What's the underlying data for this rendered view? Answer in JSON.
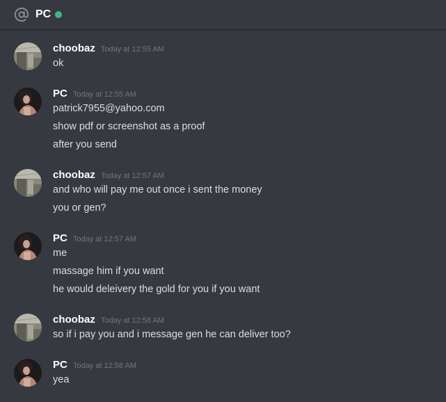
{
  "header": {
    "icon": "at-icon",
    "title": "PC",
    "status_color": "#43b581"
  },
  "messages": [
    {
      "author": "choobaz",
      "timestamp": "Today at 12:55 AM",
      "avatar": "choobaz-avatar",
      "lines": [
        "ok"
      ]
    },
    {
      "author": "PC",
      "timestamp": "Today at 12:55 AM",
      "avatar": "pc-avatar",
      "lines": [
        "patrick7955@yahoo.com",
        "show pdf or screenshot as a proof",
        "after you send"
      ]
    },
    {
      "author": "choobaz",
      "timestamp": "Today at 12:57 AM",
      "avatar": "choobaz-avatar",
      "lines": [
        "and who will pay me out once i sent the money",
        "you or gen?"
      ]
    },
    {
      "author": "PC",
      "timestamp": "Today at 12:57 AM",
      "avatar": "pc-avatar",
      "lines": [
        "me",
        "massage him if you want",
        "he would deleivery the gold for you if you want"
      ]
    },
    {
      "author": "choobaz",
      "timestamp": "Today at 12:58 AM",
      "avatar": "choobaz-avatar",
      "lines": [
        "so if i pay you and i message gen he can deliver too?"
      ]
    },
    {
      "author": "PC",
      "timestamp": "Today at 12:58 AM",
      "avatar": "pc-avatar",
      "lines": [
        "yea"
      ]
    }
  ]
}
